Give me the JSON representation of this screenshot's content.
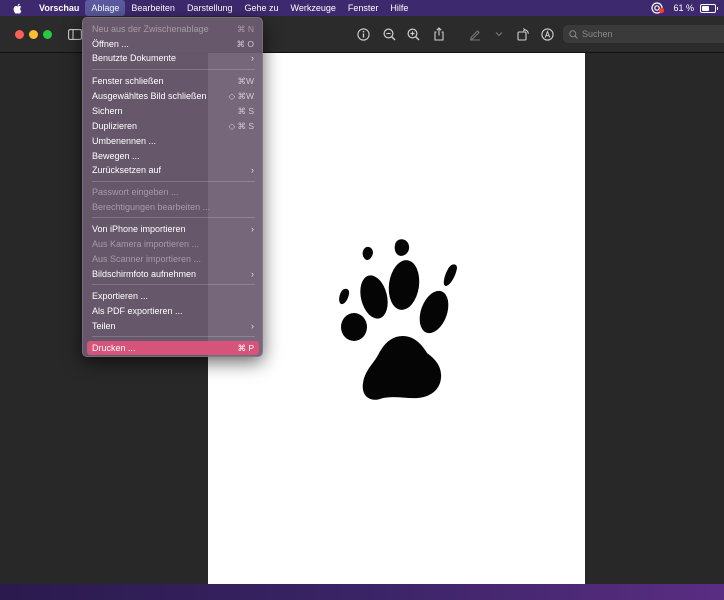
{
  "menubar": {
    "app": "Vorschau",
    "items": [
      "Ablage",
      "Bearbeiten",
      "Darstellung",
      "Gehe zu",
      "Werkzeuge",
      "Fenster",
      "Hilfe"
    ],
    "battery": "61 %"
  },
  "toolbar": {
    "search_placeholder": "Suchen"
  },
  "file_menu": {
    "items": [
      {
        "label": "Neu aus der Zwischenablage",
        "shortcut": "⌘ N"
      },
      {
        "label": "Öffnen ...",
        "shortcut": "⌘ O"
      },
      {
        "label": "Benutzte Dokumente",
        "submenu": "›"
      },
      {
        "label": "Fenster schließen",
        "shortcut": "⌘W"
      },
      {
        "label": "Ausgewähltes Bild schließen",
        "shortcut": "◇ ⌘W"
      },
      {
        "label": "Sichern",
        "shortcut": "⌘ S"
      },
      {
        "label": "Duplizieren",
        "shortcut": "◇ ⌘ S"
      },
      {
        "label": "Umbenennen ..."
      },
      {
        "label": "Bewegen ..."
      },
      {
        "label": "Zurücksetzen auf",
        "submenu": "›"
      },
      {
        "label": "Passwort eingeben ..."
      },
      {
        "label": "Berechtigungen bearbeiten ..."
      },
      {
        "label": "Von iPhone importieren",
        "submenu": "›"
      },
      {
        "label": "Aus Kamera importieren ..."
      },
      {
        "label": "Aus Scanner importieren ..."
      },
      {
        "label": "Bildschirmfoto aufnehmen",
        "submenu": "›"
      },
      {
        "label": "Exportieren ..."
      },
      {
        "label": "Als PDF exportieren ..."
      },
      {
        "label": "Teilen",
        "submenu": "›"
      },
      {
        "label": "Drucken ...",
        "shortcut": "⌘ P"
      }
    ]
  }
}
